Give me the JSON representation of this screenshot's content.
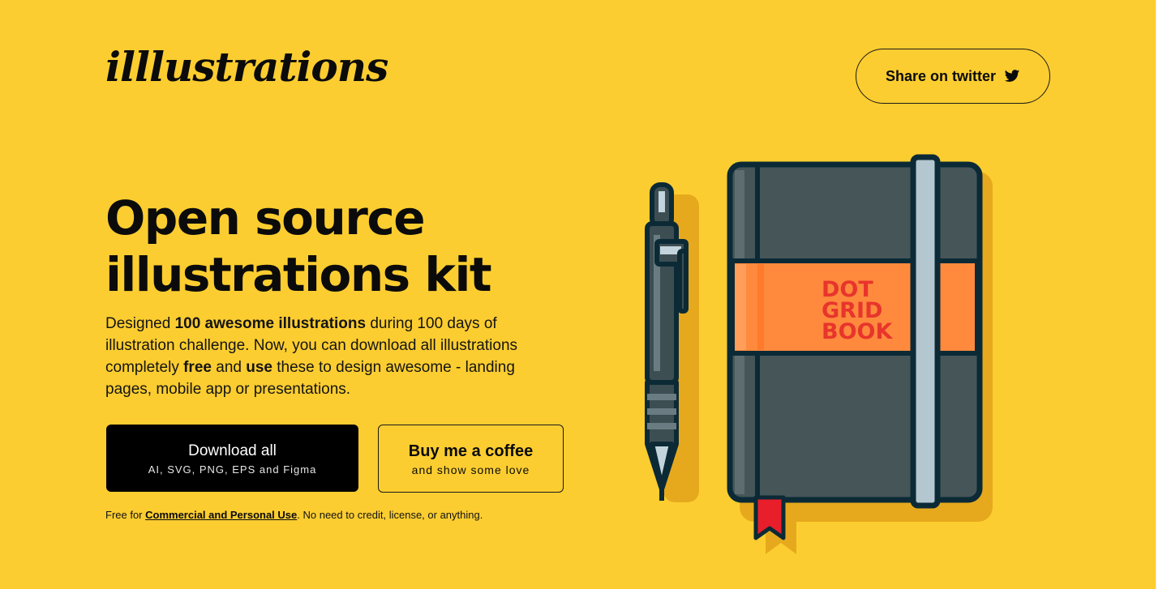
{
  "header": {
    "logo_text": "illlustrations",
    "share_label": "Share on twitter",
    "share_icon": "twitter-bird-icon"
  },
  "hero": {
    "headline_line1": "Open source",
    "headline_line2": "illustrations kit",
    "desc": {
      "p1": "Designed ",
      "b1": "100 awesome illustrations",
      "p2": " during 100 days of illustration challenge. Now, you can download all illustrations completely ",
      "b2": "free",
      "p3": " and ",
      "b3": "use",
      "p4": " these to design awesome - landing pages, mobile app or presentations."
    },
    "download": {
      "label": "Download all",
      "sub": "AI, SVG, PNG, EPS and Figma"
    },
    "coffee": {
      "label": "Buy me a coffee",
      "sub": "and show some love"
    },
    "note": {
      "prefix": "Free for ",
      "link": "Commercial and Personal Use",
      "suffix": ". No need to credit, license, or anything."
    }
  },
  "illustration": {
    "book_label_line1": "DOT",
    "book_label_line2": "GRID",
    "book_label_line3": "BOOK"
  },
  "colors": {
    "background": "#fccd30",
    "shadow": "#e6a91d",
    "book_cover": "#465558",
    "outline": "#0b2a36",
    "band": "#ff8a3d",
    "band_text": "#e8352c",
    "strap": "#b4c6cf",
    "bookmark": "#e91e2b"
  }
}
